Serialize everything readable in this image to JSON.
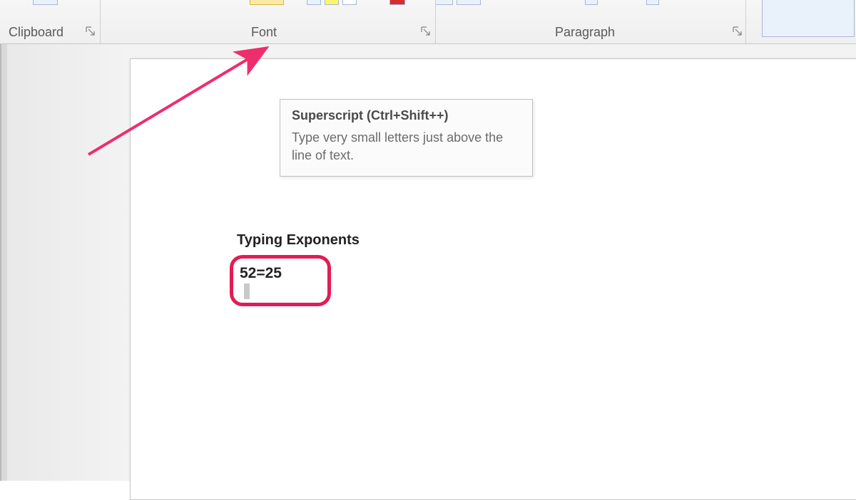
{
  "ribbon": {
    "groups": {
      "clipboard": "Clipboard",
      "font": "Font",
      "paragraph": "Paragraph"
    }
  },
  "tooltip": {
    "title": "Superscript (Ctrl+Shift++)",
    "description": "Type very small letters just above the line of text."
  },
  "document": {
    "heading": "Typing Exponents",
    "equation": "52=25"
  },
  "colors": {
    "highlight_border": "#e31b55",
    "arrow": "#ef2d6c"
  }
}
